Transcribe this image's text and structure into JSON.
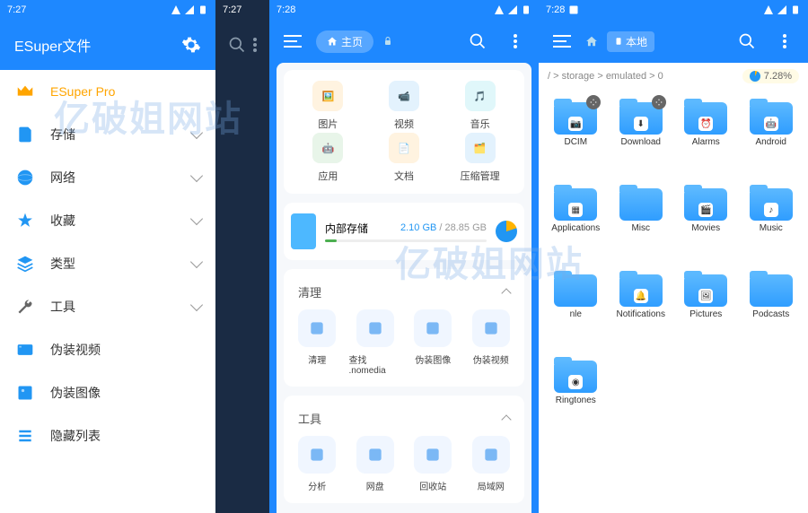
{
  "status": {
    "time1": "7:27",
    "time2": "7:27",
    "time3": "7:28",
    "time4": "7:28"
  },
  "drawer": {
    "title": "ESuper文件",
    "items": [
      {
        "label": "ESuper Pro",
        "icon": "crown",
        "color": "#ffa500",
        "expandable": false
      },
      {
        "label": "存储",
        "icon": "sdcard",
        "color": "#2196f3",
        "expandable": true
      },
      {
        "label": "网络",
        "icon": "globe",
        "color": "#2196f3",
        "expandable": true
      },
      {
        "label": "收藏",
        "icon": "star",
        "color": "#2196f3",
        "expandable": true
      },
      {
        "label": "类型",
        "icon": "layers",
        "color": "#2196f3",
        "expandable": true
      },
      {
        "label": "工具",
        "icon": "wrench",
        "color": "#666",
        "expandable": true
      },
      {
        "label": "伪装视频",
        "icon": "fake-video",
        "color": "#2196f3",
        "expandable": false
      },
      {
        "label": "伪装图像",
        "icon": "fake-image",
        "color": "#2196f3",
        "expandable": false
      },
      {
        "label": "隐藏列表",
        "icon": "list",
        "color": "#2196f3",
        "expandable": false
      }
    ]
  },
  "home": {
    "chip_label": "主页",
    "categories": [
      {
        "label": "图片",
        "bg": "#fff3e0",
        "glyph": "🖼️"
      },
      {
        "label": "视频",
        "bg": "#e3f2fd",
        "glyph": "📹"
      },
      {
        "label": "音乐",
        "bg": "#e0f7fa",
        "glyph": "🎵"
      },
      {
        "label": "应用",
        "bg": "#e8f5e9",
        "glyph": "🤖"
      },
      {
        "label": "文档",
        "bg": "#fff3e0",
        "glyph": "📄"
      },
      {
        "label": "压缩管理",
        "bg": "#e3f2fd",
        "glyph": "🗂️"
      }
    ],
    "storage": {
      "label": "内部存储",
      "used": "2.10 GB",
      "total": "28.85 GB"
    },
    "section_clean": "清理",
    "clean_items": [
      {
        "label": "清理"
      },
      {
        "label": "查找 .nomedia"
      },
      {
        "label": "伪装图像"
      },
      {
        "label": "伪装视频"
      }
    ],
    "section_tools": "工具",
    "tool_items": [
      {
        "label": "分析"
      },
      {
        "label": "网盘"
      },
      {
        "label": "回收站"
      },
      {
        "label": "局域网"
      }
    ]
  },
  "local": {
    "chip_label": "本地",
    "breadcrumb": "/  > storage > emulated >  0",
    "usage_pct": "7.28%",
    "folders": [
      {
        "name": "DCIM",
        "badge": "camera",
        "corner": true
      },
      {
        "name": "Download",
        "badge": "download",
        "corner": true
      },
      {
        "name": "Alarms",
        "badge": "alarm"
      },
      {
        "name": "Android",
        "badge": "android"
      },
      {
        "name": "Applications",
        "badge": "apps"
      },
      {
        "name": "Misc"
      },
      {
        "name": "Movies",
        "badge": "movie"
      },
      {
        "name": "Music",
        "badge": "music"
      },
      {
        "name": "nle"
      },
      {
        "name": "Notifications",
        "badge": "bell"
      },
      {
        "name": "Pictures",
        "badge": "picture"
      },
      {
        "name": "Podcasts"
      },
      {
        "name": "Ringtones",
        "badge": "ring"
      }
    ]
  }
}
